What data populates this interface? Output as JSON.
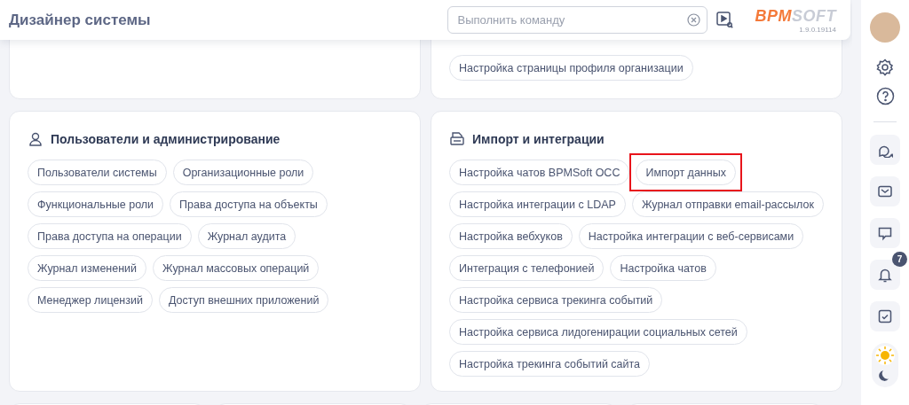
{
  "header": {
    "title": "Дизайнер системы",
    "command_search": {
      "placeholder": "Выполнить команду"
    },
    "logo": {
      "part_1": "BPM",
      "part_2": "SOFT"
    },
    "version": "1.9.0.19114"
  },
  "top_cards": [
    {
      "chips": [
        {
          "label": "Настройка страницы профиля организации"
        }
      ]
    }
  ],
  "cards": [
    {
      "title": "Пользователи и администрирование",
      "chips": [
        {
          "label": "Пользователи системы",
          "highlighted": false
        },
        {
          "label": "Организационные роли",
          "highlighted": false
        },
        {
          "label": "Функциональные роли",
          "highlighted": false
        },
        {
          "label": "Права доступа на объекты",
          "highlighted": false
        },
        {
          "label": "Права доступа на операции",
          "highlighted": false
        },
        {
          "label": "Журнал аудита",
          "highlighted": false
        },
        {
          "label": "Журнал изменений",
          "highlighted": false
        },
        {
          "label": "Журнал массовых операций",
          "highlighted": false
        },
        {
          "label": "Менеджер лицензий",
          "highlighted": false
        },
        {
          "label": "Доступ внешних приложений",
          "highlighted": false
        }
      ]
    },
    {
      "title": "Импорт и интеграции",
      "chips": [
        {
          "label": "Настройка чатов BPMSoft OCC",
          "highlighted": false
        },
        {
          "label": "Импорт данных",
          "highlighted": true
        },
        {
          "label": "Настройка интеграции с LDAP",
          "highlighted": false
        },
        {
          "label": "Журнал отправки email-рассылок",
          "highlighted": false
        },
        {
          "label": "Настройка вебхуков",
          "highlighted": false
        },
        {
          "label": "Настройка интеграции с веб-сервисами",
          "highlighted": false
        },
        {
          "label": "Интеграция с телефонией",
          "highlighted": false
        },
        {
          "label": "Настройка чатов",
          "highlighted": false
        },
        {
          "label": "Настройка сервиса трекинга событий",
          "highlighted": false
        },
        {
          "label": "Настройка сервиса лидогенирации социальных сетей",
          "highlighted": false
        },
        {
          "label": "Настройка трекинга событий сайта",
          "highlighted": false
        }
      ]
    }
  ],
  "sidebar": {
    "notifications_badge": "7",
    "dark_mode": false
  }
}
